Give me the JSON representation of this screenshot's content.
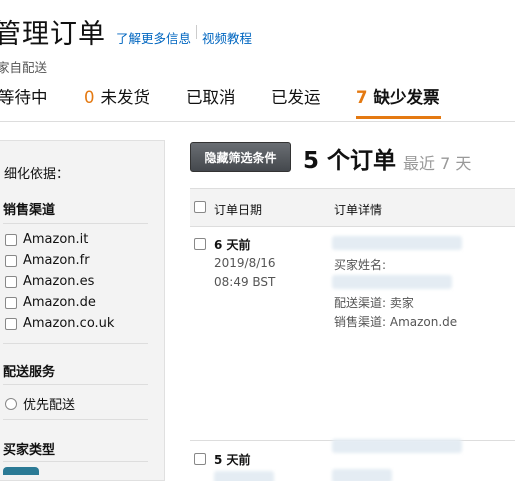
{
  "header": {
    "title": "管理订单",
    "link_learn_more": "了解更多信息",
    "link_video": "视频教程",
    "subtitle": "家自配送"
  },
  "tabs": [
    {
      "count": "",
      "label": "等待中"
    },
    {
      "count": "0",
      "label": "未发货"
    },
    {
      "count": "",
      "label": "已取消"
    },
    {
      "count": "",
      "label": "已发运"
    },
    {
      "count": "7",
      "label": "缺少发票"
    }
  ],
  "sidebar": {
    "refine_label": "细化依据：",
    "sales_channel": {
      "heading": "销售渠道",
      "options": [
        "Amazon.it",
        "Amazon.fr",
        "Amazon.es",
        "Amazon.de",
        "Amazon.co.uk"
      ]
    },
    "fulfillment": {
      "heading": "配送服务",
      "options": [
        "优先配送"
      ]
    },
    "buyer_type": {
      "heading": "买家类型"
    }
  },
  "toolbar": {
    "hide_filters_label": "隐藏筛选条件",
    "order_count": "5 个订单",
    "recent_range": "最近 7 天"
  },
  "table": {
    "columns": [
      "订单日期",
      "订单详情"
    ],
    "rows": [
      {
        "days_ago": "6 天前",
        "date": "2019/8/16",
        "time": "08:49 BST",
        "buyer_name_label": "买家姓名:",
        "fulfillment_channel": "配送渠道: 卖家",
        "sales_channel": "销售渠道: Amazon.de"
      },
      {
        "days_ago": "5 天前"
      }
    ]
  },
  "colors": {
    "accent": "#e47911",
    "link": "#0066c0",
    "sidebar_bg": "#f3f3f3"
  }
}
